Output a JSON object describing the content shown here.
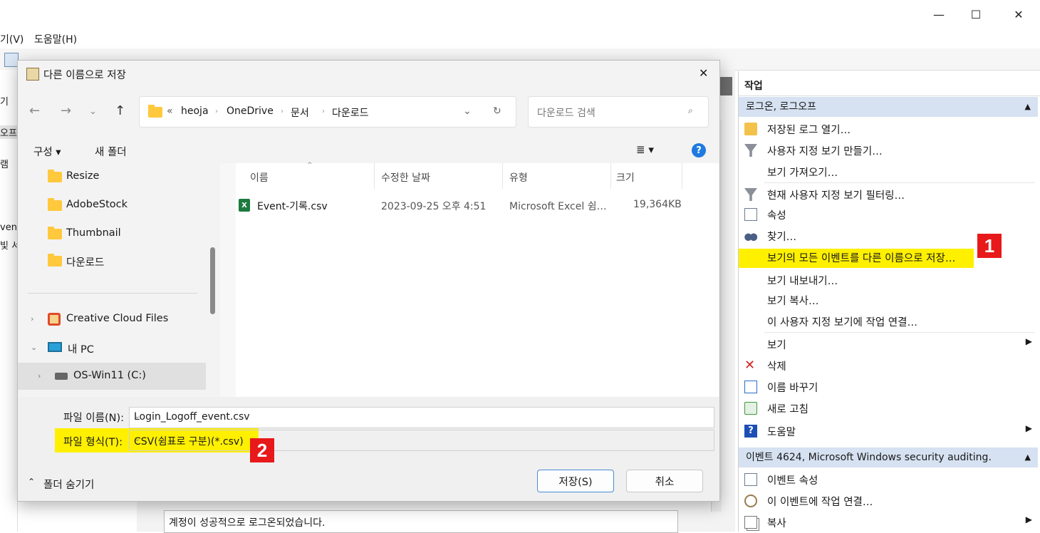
{
  "window": {
    "minimize_glyph": "—",
    "maximize_glyph": "☐",
    "close_glyph": "✕"
  },
  "menubar": {
    "view_label": "기(V)",
    "help_label": "도움말(H)"
  },
  "left_strip": {
    "fragments": [
      "기",
      "오프",
      "램",
      "vent",
      "빛 서"
    ]
  },
  "actions_panel": {
    "title": "작업",
    "section1": "로그온, 로그오프",
    "items1": [
      {
        "label": "저장된 로그 열기…",
        "icon": "folder-open-icon"
      },
      {
        "label": "사용자 지정 보기 만들기…",
        "icon": "filter-icon"
      },
      {
        "label": "보기 가져오기…",
        "icon": ""
      },
      {
        "label": "현재 사용자 지정 보기 필터링…",
        "icon": "filter-icon"
      },
      {
        "label": "속성",
        "icon": "properties-icon"
      },
      {
        "label": "찾기…",
        "icon": "binoculars-icon"
      },
      {
        "label": "보기의 모든 이벤트를 다른 이름으로 저장…",
        "icon": "save-icon"
      },
      {
        "label": "보기 내보내기…",
        "icon": ""
      },
      {
        "label": "보기 복사…",
        "icon": ""
      },
      {
        "label": "이 사용자 지정 보기에 작업 연결…",
        "icon": ""
      },
      {
        "label": "보기",
        "icon": "",
        "submenu": "▶"
      },
      {
        "label": "삭제",
        "icon": "delete-icon"
      },
      {
        "label": "이름 바꾸기",
        "icon": "rename-icon"
      },
      {
        "label": "새로 고침",
        "icon": "refresh-icon"
      },
      {
        "label": "도움말",
        "icon": "help-icon",
        "submenu": "▶"
      }
    ],
    "section2": "이벤트 4624, Microsoft Windows security auditing.",
    "items2": [
      {
        "label": "이벤트 속성",
        "icon": "event-properties-icon"
      },
      {
        "label": "이 이벤트에 작업 연결…",
        "icon": "task-icon"
      },
      {
        "label": "복사",
        "icon": "copy-icon",
        "submenu": "▶"
      }
    ],
    "collapse_glyph": "▲"
  },
  "status_text": "계정이 성공적으로 로그온되었습니다.",
  "badges": {
    "one": "1",
    "two": "2"
  },
  "colors": {
    "highlight": "#fff000",
    "badge": "#e8191a",
    "section": "#d6e2f2"
  },
  "dialog": {
    "title": "다른 이름으로 저장",
    "close_glyph": "✕",
    "breadcrumb": [
      "heoja",
      "OneDrive",
      "문서",
      "다운로드"
    ],
    "breadcrumb_overflow": "«",
    "search_placeholder": "다운로드 검색",
    "organize_label": "구성 ▾",
    "new_folder_label": "새 폴더",
    "view_glyph": "≣ ▾",
    "help_glyph": "?",
    "nav_items": [
      {
        "label": "Resize",
        "icon": "folder-icon"
      },
      {
        "label": "AdobeStock",
        "icon": "folder-icon"
      },
      {
        "label": "Thumbnail",
        "icon": "folder-icon"
      },
      {
        "label": "다운로드",
        "icon": "folder-icon"
      },
      {
        "label": "Creative Cloud Files",
        "icon": "creative-cloud-icon",
        "chevron": "›"
      },
      {
        "label": "내 PC",
        "icon": "pc-icon",
        "chevron": "⌄"
      },
      {
        "label": "OS-Win11 (C:)",
        "icon": "drive-icon",
        "chevron": "›",
        "selected": true
      }
    ],
    "columns": [
      "이름",
      "수정한 날짜",
      "유형",
      "크기"
    ],
    "files": [
      {
        "name": "Event-기록.csv",
        "modified": "2023-09-25 오후 4:51",
        "type": "Microsoft Excel 쉼…",
        "size": "19,364KB",
        "icon": "excel-csv-icon"
      }
    ],
    "filename_label": "파일 이름(N):",
    "filename_value": "Login_Logoff_event.csv",
    "filetype_label": "파일 형식(T):",
    "filetype_value": "CSV(쉼표로 구분)(*.csv)",
    "hide_folders_label": "폴더 숨기기",
    "save_label": "저장(S)",
    "cancel_label": "취소"
  }
}
